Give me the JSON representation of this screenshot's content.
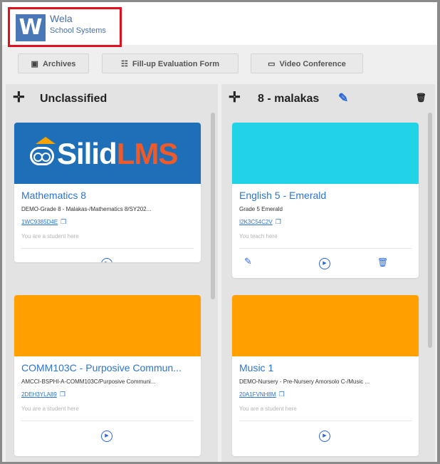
{
  "brand": {
    "name": "Wela",
    "subtitle": "School Systems",
    "mark": "W"
  },
  "toolbar": {
    "archives": "Archives",
    "evaluation": "Fill-up Evaluation Form",
    "video": "Video Conference"
  },
  "columns": [
    {
      "title": "Unclassified",
      "cards": [
        {
          "banner_text_1": "Silid",
          "banner_text_2": "LMS",
          "banner_color": "#1f6fb8",
          "title": "Mathematics 8",
          "description": "DEMO-Grade 8 - Malakas-/Mathematics 8/SY202...",
          "code": "1WC9385D4E",
          "role": "You are a student here"
        },
        {
          "banner_color": "#ffa000",
          "title": "COMM103C - Purposive Commun...",
          "description": "AMCCI-BSPHI-A-COMM103C/Purposive Communi...",
          "code": "2DEH3YLA89",
          "role": "You are a student here"
        }
      ]
    },
    {
      "title": "8 - malakas",
      "cards": [
        {
          "banner_color": "#22d3e8",
          "title": "English 5 - Emerald",
          "description": "Grade 5 Emerald",
          "code": "I2K3C54C2V",
          "role": "You teach here"
        },
        {
          "banner_color": "#ffa000",
          "title": "Music 1",
          "description": "DEMO-Nursery - Pre-Nursery Amorsolo C-/Music ...",
          "code": "20A1FVNH8M",
          "role": "You are a student here"
        }
      ]
    }
  ]
}
